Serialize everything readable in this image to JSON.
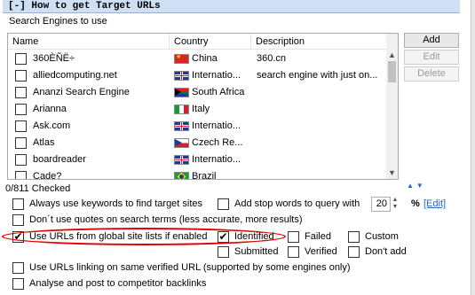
{
  "header": {
    "title": "[-] How to get Target URLs"
  },
  "engines": {
    "label": "Search Engines to use",
    "columns": {
      "name": "Name",
      "country": "Country",
      "description": "Description"
    },
    "rows": [
      {
        "name": "360ÈÑË÷",
        "country": "China",
        "description": "360.cn",
        "flag": "cn"
      },
      {
        "name": "alliedcomputing.net",
        "country": "Internatio...",
        "description": "search engine with just on...",
        "flag": "uk"
      },
      {
        "name": "Ananzi Search Engine",
        "country": "South Africa",
        "description": "",
        "flag": "za"
      },
      {
        "name": "Arianna",
        "country": "Italy",
        "description": "",
        "flag": "it"
      },
      {
        "name": "Ask.com",
        "country": "Internatio...",
        "description": "",
        "flag": "uk"
      },
      {
        "name": "Atlas",
        "country": "Czech Re...",
        "description": "",
        "flag": "cz"
      },
      {
        "name": "boardreader",
        "country": "Internatio...",
        "description": "",
        "flag": "uk"
      },
      {
        "name": "Cade?",
        "country": "Brazil",
        "description": "",
        "flag": "br"
      }
    ],
    "checked_count": "0/811 Checked"
  },
  "buttons": {
    "add": "Add",
    "edit": "Edit",
    "delete": "Delete"
  },
  "options": {
    "always_keywords": "Always use keywords to find target sites",
    "stop_words": "Add stop words to query with",
    "stop_words_value": "20",
    "percent": "%",
    "edit_link": "[Edit]",
    "no_quotes": "Don´t use quotes on search terms (less accurate, more results)",
    "global_lists": "Use URLs from global site lists if enabled",
    "identified": "Identified",
    "failed": "Failed",
    "custom": "Custom",
    "submitted": "Submitted",
    "verified": "Verified",
    "dont_add": "Don't add",
    "linking_verified": "Use URLs linking on same verified URL (supported by some engines only)",
    "competitor": "Analyse and post to competitor backlinks"
  },
  "colors": {
    "header_bg": "#cfe0f5",
    "link": "#2a64c5",
    "annotation": "#e00000"
  }
}
